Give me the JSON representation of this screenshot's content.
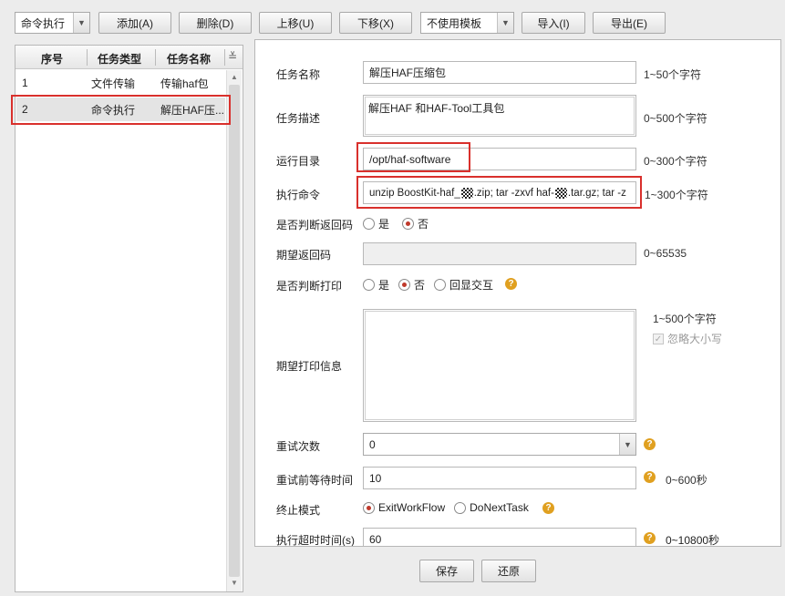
{
  "toolbar": {
    "task_type_select": "命令执行",
    "add": "添加(A)",
    "delete": "删除(D)",
    "move_up": "上移(U)",
    "move_down": "下移(X)",
    "template_select": "不使用模板",
    "import": "导入(I)",
    "export": "导出(E)"
  },
  "task_list": {
    "columns": [
      "序号",
      "任务类型",
      "任务名称"
    ],
    "rows": [
      {
        "no": "1",
        "type": "文件传输",
        "name": "传输haf包"
      },
      {
        "no": "2",
        "type": "命令执行",
        "name": "解压HAF压..."
      }
    ]
  },
  "form": {
    "task_name": {
      "label": "任务名称",
      "value": "解压HAF压缩包",
      "hint": "1~50个字符"
    },
    "task_desc": {
      "label": "任务描述",
      "value": "解压HAF 和HAF-Tool工具包",
      "hint": "0~500个字符"
    },
    "run_dir": {
      "label": "运行目录",
      "value": "/opt/haf-software",
      "hint": "0~300个字符"
    },
    "exec_cmd": {
      "label": "执行命令",
      "value_part1": "unzip BoostKit-haf_",
      "value_part2": ".zip; tar -zxvf haf-",
      "value_part3": ".tar.gz; tar -z",
      "hint": "1~300个字符"
    },
    "check_return": {
      "label": "是否判断返回码",
      "options": [
        "是",
        "否"
      ],
      "selected": "否"
    },
    "expected_return": {
      "label": "期望返回码",
      "value": "",
      "hint": "0~65535"
    },
    "check_print": {
      "label": "是否判断打印",
      "options": [
        "是",
        "否",
        "回显交互"
      ],
      "selected": "否"
    },
    "expected_print": {
      "label": "期望打印信息",
      "value": "",
      "hint": "1~500个字符",
      "ignore_case": "忽略大小写"
    },
    "retry_count": {
      "label": "重试次数",
      "value": "0"
    },
    "retry_wait": {
      "label": "重试前等待时间",
      "value": "10",
      "hint": "0~600秒"
    },
    "stop_mode": {
      "label": "终止模式",
      "options": [
        "ExitWorkFlow",
        "DoNextTask"
      ],
      "selected": "ExitWorkFlow"
    },
    "exec_timeout": {
      "label": "执行超时时间(s)",
      "value": "60",
      "hint": "0~10800秒"
    }
  },
  "footer": {
    "save": "保存",
    "restore": "还原"
  },
  "icons": {
    "help": "?",
    "dropdown": "▼",
    "scroll_up": "▲",
    "scroll_down": "▼",
    "column_menu": "≚"
  },
  "colors": {
    "highlight": "#d9302c",
    "radio_dot": "#c0392b",
    "help": "#e0a020"
  }
}
